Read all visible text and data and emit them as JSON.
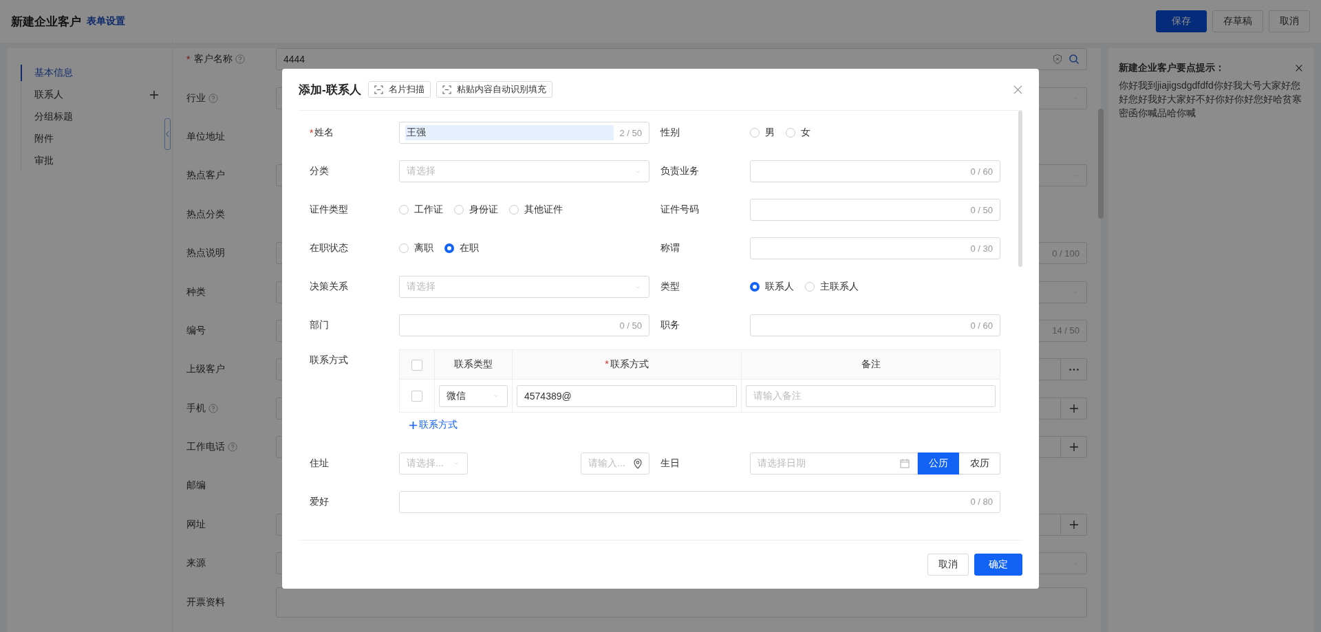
{
  "header": {
    "title": "新建企业客户",
    "link": "表单设置",
    "buttons": [
      {
        "label": "保存",
        "kind": "primary"
      },
      {
        "label": "存草稿",
        "kind": "default"
      },
      {
        "label": "取消",
        "kind": "default"
      }
    ]
  },
  "nav": [
    {
      "label": "基本信息",
      "selected": true,
      "add": false
    },
    {
      "label": "联系人",
      "selected": false,
      "add": true
    },
    {
      "label": "分组标题",
      "selected": false,
      "add": false
    },
    {
      "label": "附件",
      "selected": false,
      "add": false
    },
    {
      "label": "审批",
      "selected": false,
      "add": false
    }
  ],
  "form": {
    "fields": [
      {
        "label": "客户名称",
        "mark": "*",
        "help": true,
        "kind": "search",
        "value": "4444"
      },
      {
        "label": "行业",
        "help": true,
        "kind": "select"
      },
      {
        "label": "单位地址",
        "help": false,
        "kind": "none"
      },
      {
        "label": "热点客户",
        "help": false,
        "kind": "select"
      },
      {
        "label": "热点分类",
        "help": false,
        "kind": "none"
      },
      {
        "label": "热点说明",
        "help": false,
        "kind": "counter",
        "count": "0 / 100"
      },
      {
        "label": "种类",
        "help": false,
        "kind": "select"
      },
      {
        "label": "编号",
        "help": false,
        "kind": "counter",
        "count": "14 / 50"
      },
      {
        "label": "上级客户",
        "help": false,
        "kind": "more"
      },
      {
        "label": "手机",
        "help": true,
        "kind": "add"
      },
      {
        "label": "工作电话",
        "help": true,
        "kind": "add"
      },
      {
        "label": "邮编",
        "help": false,
        "kind": "none"
      },
      {
        "label": "网址",
        "help": false,
        "kind": "add"
      },
      {
        "label": "来源",
        "help": false,
        "kind": "select"
      },
      {
        "label": "开票资料",
        "help": false,
        "kind": "textarea"
      }
    ]
  },
  "tips": {
    "title": "新建企业客户要点提示：",
    "text": "你好我到jiajigsdgdfdfd你好我大号大家好您好您好我好大家好不好你好你好您好哈贫寒密函你喊品哈你喊"
  },
  "dialog": {
    "title": "添加-联系人",
    "tools": [
      "名片扫描",
      "粘贴内容自动识别填充"
    ],
    "fields": [
      {
        "label": "姓名",
        "mark": "*",
        "kind": "text",
        "value": "王强",
        "value_selected": true,
        "count": "2 / 50"
      },
      {
        "label": "性别",
        "kind": "radio",
        "options": [
          {
            "label": "男",
            "selected": false
          },
          {
            "label": "女",
            "selected": false
          }
        ]
      },
      {
        "label": "分类",
        "kind": "select",
        "placeholder": "请选择"
      },
      {
        "label": "负责业务",
        "kind": "text",
        "count": "0 / 60"
      },
      {
        "label": "证件类型",
        "kind": "radio",
        "options": [
          {
            "label": "工作证",
            "selected": false
          },
          {
            "label": "身份证",
            "selected": false
          },
          {
            "label": "其他证件",
            "selected": false
          }
        ]
      },
      {
        "label": "证件号码",
        "kind": "text",
        "count": "0 / 50"
      },
      {
        "label": "在职状态",
        "kind": "radio",
        "options": [
          {
            "label": "离职",
            "selected": false
          },
          {
            "label": "在职",
            "selected": true
          }
        ]
      },
      {
        "label": "称谓",
        "kind": "text",
        "count": "0 / 30"
      },
      {
        "label": "决策关系",
        "kind": "select",
        "placeholder": "请选择"
      },
      {
        "label": "类型",
        "kind": "radio",
        "options": [
          {
            "label": "联系人",
            "selected": true
          },
          {
            "label": "主联系人",
            "selected": false
          }
        ]
      },
      {
        "label": "部门",
        "kind": "text",
        "count": "0 / 50"
      },
      {
        "label": "职务",
        "kind": "text",
        "count": "0 / 60"
      }
    ],
    "contacts": {
      "label": "联系方式",
      "header_checked": false,
      "columns": [
        {
          "label": "联系类型"
        },
        {
          "label": "联系方式",
          "mark": "*"
        },
        {
          "label": "备注"
        }
      ],
      "rows": [
        {
          "checked": false,
          "type": "微信",
          "value": "4574389@",
          "note_placeholder": "请输入备注"
        }
      ],
      "add_link": "联系方式"
    },
    "address": {
      "label": "住址",
      "region_placeholder": "请选择...",
      "detail_placeholder": "请输入..."
    },
    "birthday": {
      "label": "生日",
      "placeholder": "请选择日期",
      "calendars": [
        {
          "label": "公历",
          "selected": true
        },
        {
          "label": "农历",
          "selected": false
        }
      ]
    },
    "hobby": {
      "label": "爱好",
      "count": "0 / 80"
    },
    "footer": [
      {
        "label": "取消",
        "kind": "default"
      },
      {
        "label": "确定",
        "kind": "primary"
      }
    ]
  }
}
